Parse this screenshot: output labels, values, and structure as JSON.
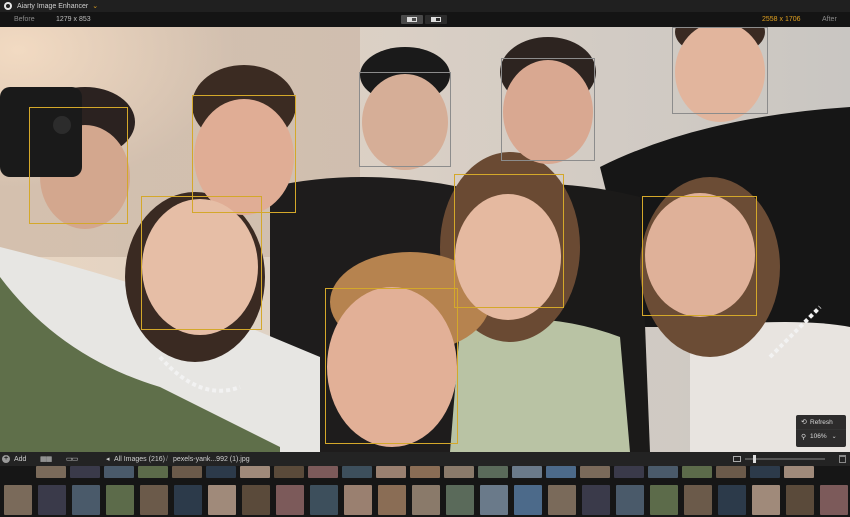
{
  "app": {
    "title": "Aiarty Image Enhancer"
  },
  "compare": {
    "before_label": "Before",
    "before_size": "1279 x 853",
    "after_size": "2558 x 1706",
    "after_label": "After"
  },
  "viewer": {
    "zoom_panel": {
      "refresh_label": "Refresh",
      "zoom_value": "106%"
    }
  },
  "toolbar": {
    "add_label": "Add",
    "path_label": "All Images (216)",
    "separator": "/",
    "file_name": "pexels-yank...992 (1).jpg"
  },
  "colors": {
    "accent": "#e0a020",
    "face_box": "#d4a82a",
    "face_box_secondary": "#8c8c8c"
  }
}
